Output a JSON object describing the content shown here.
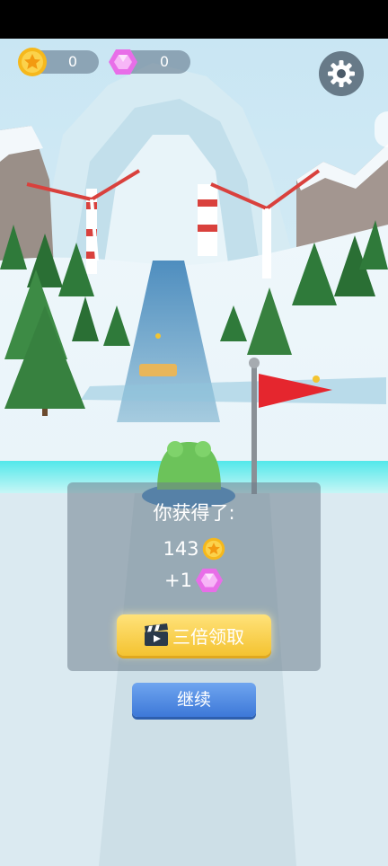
{
  "hud": {
    "coins": "0",
    "gems": "0"
  },
  "reward_panel": {
    "title": "你获得了:",
    "coin_amount": "143",
    "gem_amount": "+1",
    "triple_button_label": "三倍领取"
  },
  "continue_button_label": "继续",
  "icons": {
    "coin": "star-coin-icon",
    "gem": "pink-gem-icon",
    "settings": "gear-icon",
    "video": "clapperboard-icon"
  },
  "colors": {
    "coin_gold": "#f6b81c",
    "gem_pink": "#e86ee8",
    "button_yellow": "#f4c331",
    "button_blue": "#3d78d8",
    "flag_red": "#e5262e",
    "frog_green": "#6cc35a"
  }
}
